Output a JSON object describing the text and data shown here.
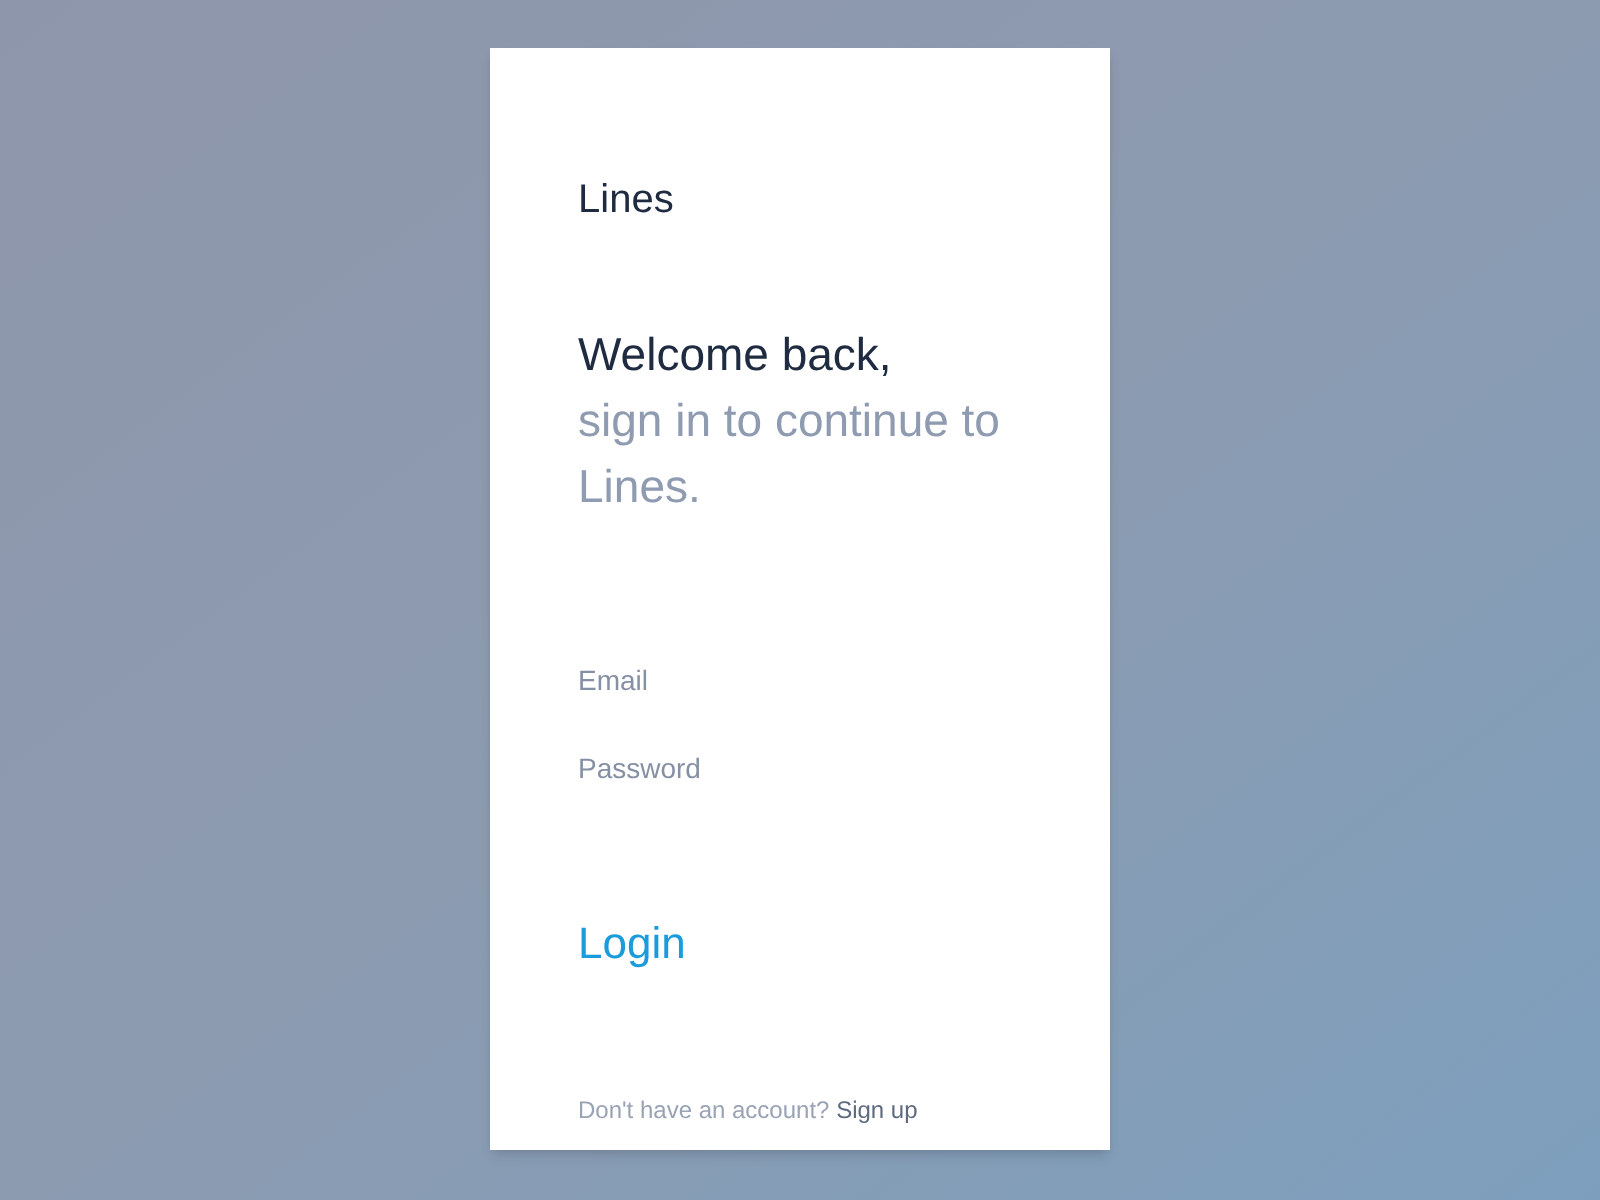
{
  "app_title": "Lines",
  "heading": {
    "greeting": "Welcome back,",
    "subtitle": "sign in to continue to Lines."
  },
  "fields": [
    {
      "placeholder": "Email"
    },
    {
      "placeholder": "Password"
    }
  ],
  "login_button": "Login",
  "footer": {
    "prompt": "Don't have an account?",
    "link": "Sign up"
  }
}
